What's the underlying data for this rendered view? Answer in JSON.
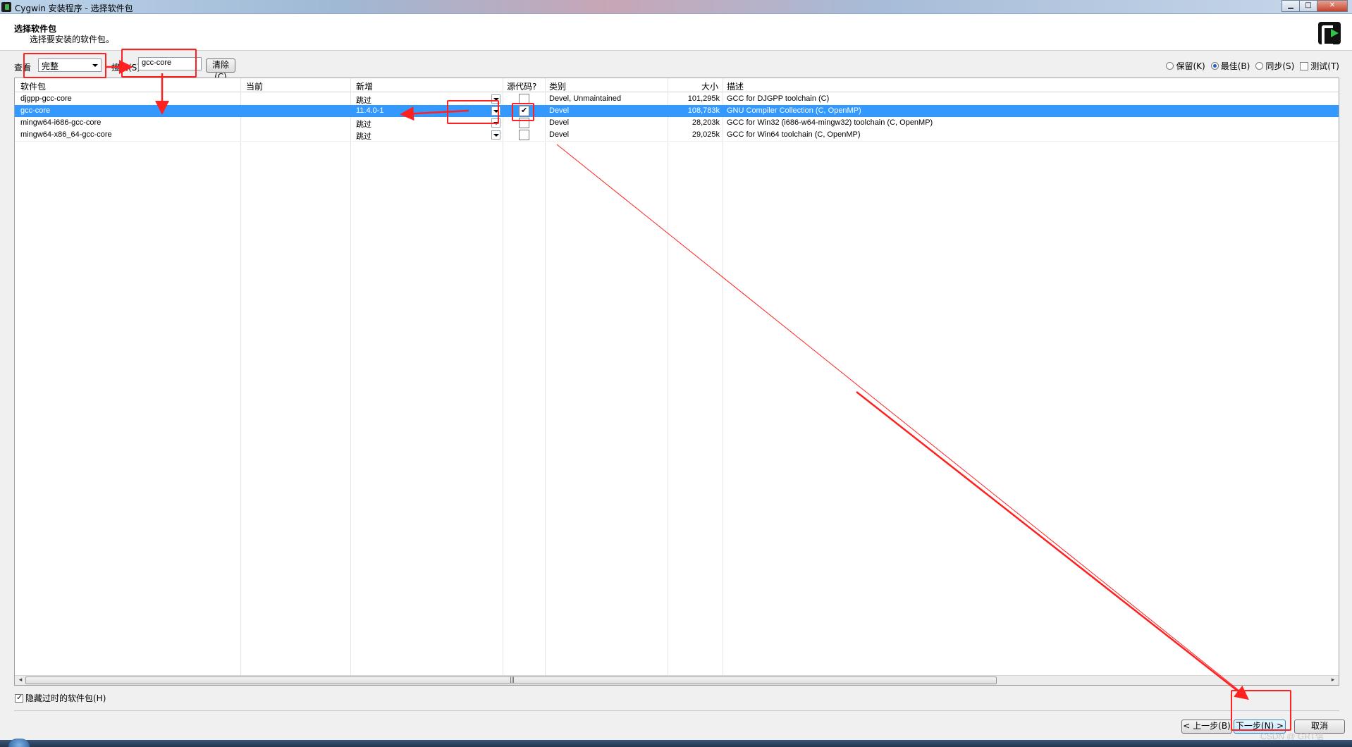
{
  "window": {
    "title": "Cygwin 安装程序 - 选择软件包",
    "minimize": "▁",
    "maximize": "□",
    "close": "✕"
  },
  "header": {
    "title": "选择软件包",
    "subtitle": "选择要安装的软件包。",
    "logo_icon": "cygwin-logo"
  },
  "toolbar": {
    "view_label": "查看",
    "view_value": "完整",
    "search_label": "搜索(S)",
    "search_value": "gcc-core",
    "clear_label": "清除(C)",
    "radios": [
      {
        "label": "保留(K)",
        "selected": false
      },
      {
        "label": "最佳(B)",
        "selected": true
      },
      {
        "label": "同步(S)",
        "selected": false
      }
    ],
    "test_label": "测试(T)"
  },
  "table": {
    "columns": [
      "软件包",
      "当前",
      "新增",
      "源代码?",
      "类别",
      "大小",
      "描述"
    ],
    "rows": [
      {
        "package": "djgpp-gcc-core",
        "current": "",
        "new": "跳过",
        "src": false,
        "category": "Devel, Unmaintained",
        "size": "101,295k",
        "desc": "GCC for DJGPP toolchain (C)",
        "selected": false
      },
      {
        "package": "gcc-core",
        "current": "",
        "new": "11.4.0-1",
        "src": true,
        "category": "Devel",
        "size": "108,783k",
        "desc": "GNU Compiler Collection (C, OpenMP)",
        "selected": true
      },
      {
        "package": "mingw64-i686-gcc-core",
        "current": "",
        "new": "跳过",
        "src": false,
        "category": "Devel",
        "size": "28,203k",
        "desc": "GCC for Win32 (i686-w64-mingw32) toolchain (C, OpenMP)",
        "selected": false
      },
      {
        "package": "mingw64-x86_64-gcc-core",
        "current": "",
        "new": "跳过",
        "src": false,
        "category": "Devel",
        "size": "29,025k",
        "desc": "GCC for Win64 toolchain (C, OpenMP)",
        "selected": false
      }
    ]
  },
  "footer": {
    "hide_obsolete": "隐藏过时的软件包(H)",
    "hide_obsolete_checked": true,
    "back": "< 上一步(B)",
    "next": "下一步(N) >",
    "cancel": "取消"
  },
  "watermark": "CSDN @ GRT信",
  "colors": {
    "selection": "#3399ff",
    "annotation": "#ff2020"
  }
}
